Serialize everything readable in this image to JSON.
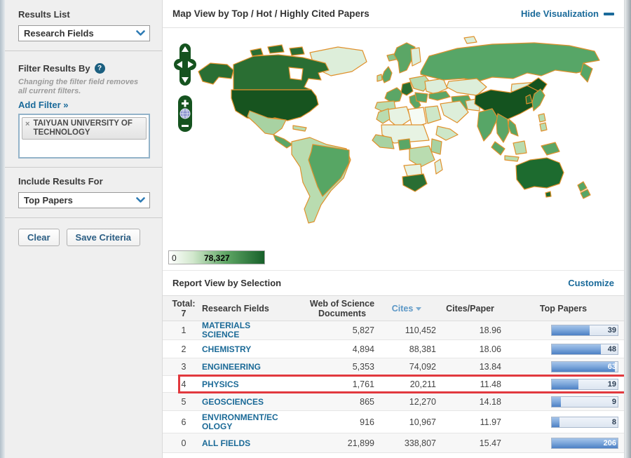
{
  "colors": {
    "link_blue": "#1a6a9a",
    "highlight_red": "#e1393e",
    "map_border_orange": "#e0912c",
    "legend_green_dark": "#17602a",
    "bar_blue": "#4c80c4"
  },
  "sidebar": {
    "results_list_label": "Results List",
    "results_list_value": "Research Fields",
    "filter_heading": "Filter Results By",
    "filter_help": "?",
    "filter_note": "Changing the filter field removes all current filters.",
    "add_filter": "Add Filter »",
    "filter_tag": {
      "remove": "×",
      "label": "TAIYUAN UNIVERSITY OF TECHNOLOGY"
    },
    "include_label": "Include Results For",
    "include_value": "Top Papers",
    "clear_button": "Clear",
    "save_button": "Save Criteria"
  },
  "map": {
    "title": "Map View by Top / Hot / Highly Cited Papers",
    "hide_visualization": "Hide Visualization",
    "legend_min": "0",
    "legend_max": "78,327",
    "zoom_plus": "+",
    "zoom_minus": "−"
  },
  "report": {
    "title": "Report View by Selection",
    "customize": "Customize",
    "columns": {
      "total_label": "Total:",
      "total_count": "7",
      "research_fields": "Research Fields",
      "wos_documents": "Web of Science Documents",
      "cites": "Cites",
      "cites_per_paper": "Cites/Paper",
      "top_papers": "Top Papers"
    },
    "rows": [
      {
        "rank": "1",
        "field": "MATERIALS SCIENCE",
        "documents": "5,827",
        "cites": "110,452",
        "cites_per_paper": "18.96",
        "top_papers": "39",
        "bar_pct": 57,
        "highlighted": false
      },
      {
        "rank": "2",
        "field": "CHEMISTRY",
        "documents": "4,894",
        "cites": "88,381",
        "cites_per_paper": "18.06",
        "top_papers": "48",
        "bar_pct": 74,
        "highlighted": false
      },
      {
        "rank": "3",
        "field": "ENGINEERING",
        "documents": "5,353",
        "cites": "74,092",
        "cites_per_paper": "13.84",
        "top_papers": "63",
        "bar_pct": 96,
        "highlighted": false
      },
      {
        "rank": "4",
        "field": "PHYSICS",
        "documents": "1,761",
        "cites": "20,211",
        "cites_per_paper": "11.48",
        "top_papers": "19",
        "bar_pct": 40,
        "highlighted": true
      },
      {
        "rank": "5",
        "field": "GEOSCIENCES",
        "documents": "865",
        "cites": "12,270",
        "cites_per_paper": "14.18",
        "top_papers": "9",
        "bar_pct": 14,
        "highlighted": false
      },
      {
        "rank": "6",
        "field": "ENVIRONMENT/ECOLOGY",
        "documents": "916",
        "cites": "10,967",
        "cites_per_paper": "11.97",
        "top_papers": "8",
        "bar_pct": 12,
        "highlighted": false
      },
      {
        "rank": "0",
        "field": "ALL FIELDS",
        "documents": "21,899",
        "cites": "338,807",
        "cites_per_paper": "15.47",
        "top_papers": "206",
        "bar_pct": 100,
        "highlighted": false
      }
    ]
  }
}
